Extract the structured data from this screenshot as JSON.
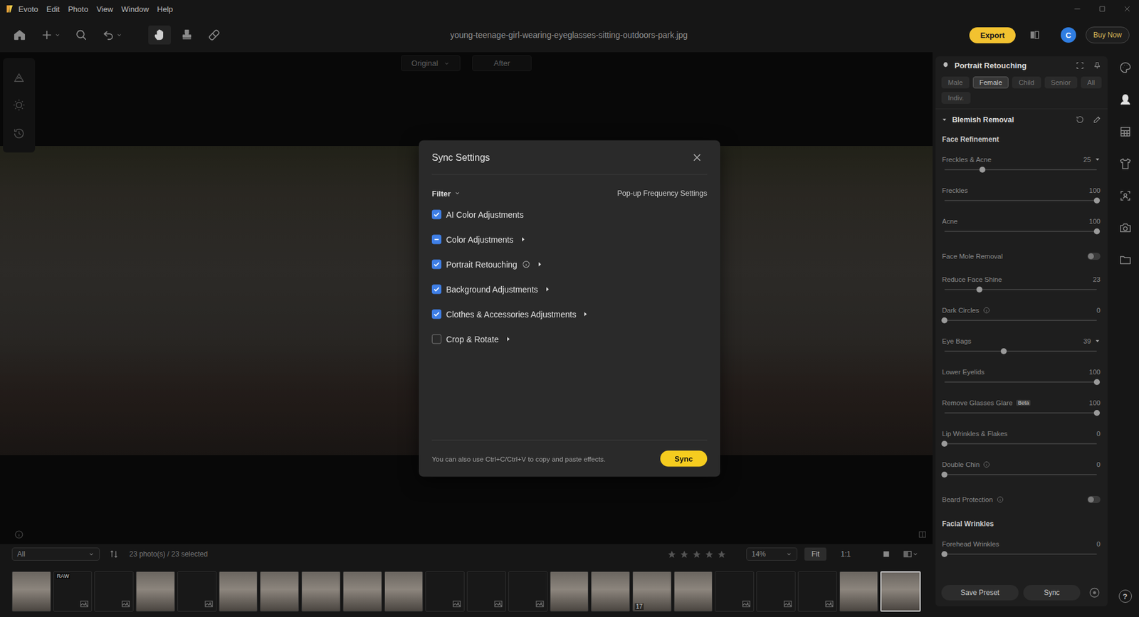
{
  "window": {
    "app": "Evoto",
    "title": "young-teenage-girl-wearing-eyeglasses-sitting-outdoors-park.jpg"
  },
  "menu": [
    "Edit",
    "Photo",
    "View",
    "Window",
    "Help"
  ],
  "toolbar": {
    "tools": [
      {
        "selected": false,
        "dropdown": false
      },
      {
        "selected": false,
        "dropdown": true
      },
      {
        "selected": false,
        "dropdown": false
      },
      {
        "selected": false,
        "dropdown": true
      },
      {
        "selected": true,
        "dropdown": false
      },
      {
        "selected": false,
        "dropdown": false
      },
      {
        "selected": false,
        "dropdown": false
      }
    ],
    "export": "Export",
    "avatar": "C",
    "buy": "Buy Now"
  },
  "left_tools": [
    {
      "selected": false
    },
    {
      "selected": false
    },
    {
      "selected": false
    }
  ],
  "view_toggle": [
    {
      "label": "Original",
      "dropdown": true
    },
    {
      "label": "After",
      "dropdown": false
    }
  ],
  "dialog": {
    "title": "Sync Settings",
    "filter": "Filter",
    "frequency": "Pop-up Frequency Settings",
    "items": [
      {
        "label": "AI Color Adjustments",
        "checked": true,
        "partial": false,
        "info": false,
        "expandable": false
      },
      {
        "label": "Color Adjustments",
        "checked": false,
        "partial": true,
        "info": false,
        "expandable": true
      },
      {
        "label": "Portrait Retouching",
        "checked": true,
        "partial": false,
        "info": true,
        "expandable": true
      },
      {
        "label": "Background Adjustments",
        "checked": true,
        "partial": false,
        "info": false,
        "expandable": true
      },
      {
        "label": "Clothes & Accessories Adjustments",
        "checked": true,
        "partial": false,
        "info": false,
        "expandable": true
      },
      {
        "label": "Crop & Rotate",
        "checked": false,
        "partial": false,
        "info": false,
        "expandable": true
      }
    ],
    "hint": "You can also use Ctrl+C/Ctrl+V to copy and paste effects.",
    "button": "Sync"
  },
  "panel": {
    "title": "Portrait Retouching",
    "profiles": [
      {
        "label": "Male",
        "selected": false
      },
      {
        "label": "Female",
        "selected": true
      },
      {
        "label": "Child",
        "selected": false
      },
      {
        "label": "Senior",
        "selected": false
      },
      {
        "label": "All",
        "selected": false
      },
      {
        "label": "Indiv.",
        "selected": false
      }
    ],
    "section": {
      "title": "Blemish Removal",
      "expanded": true
    },
    "rows": [
      {
        "kind": "heading",
        "label": "Face Refinement"
      },
      {
        "kind": "slider",
        "label": "Freckles & Acne",
        "value": "25",
        "level": 0.25,
        "expanded": true
      },
      {
        "kind": "slider",
        "label": "Freckles",
        "value": "100",
        "level": 1
      },
      {
        "kind": "slider",
        "label": "Acne",
        "value": "100",
        "level": 1
      },
      {
        "kind": "toggle",
        "label": "Face Mole Removal",
        "on": false
      },
      {
        "kind": "slider",
        "label": "Reduce Face Shine",
        "value": "23",
        "level": 0.23
      },
      {
        "kind": "slider",
        "label": "Dark Circles",
        "value": "0",
        "level": 0,
        "info": true
      },
      {
        "kind": "slider",
        "label": "Eye Bags",
        "value": "39",
        "level": 0.39,
        "expanded": true
      },
      {
        "kind": "slider",
        "label": "Lower Eyelids",
        "value": "100",
        "level": 1
      },
      {
        "kind": "slider",
        "label": "Remove Glasses Glare",
        "badge": "Beta",
        "value": "100",
        "level": 1
      },
      {
        "kind": "slider",
        "label": "Lip Wrinkles & Flakes",
        "value": "0",
        "level": 0
      },
      {
        "kind": "slider",
        "label": "Double Chin",
        "value": "0",
        "level": 0,
        "info": true
      },
      {
        "kind": "toggle",
        "label": "Beard Protection",
        "on": false,
        "info": true
      },
      {
        "kind": "heading",
        "label": "Facial Wrinkles"
      },
      {
        "kind": "slider",
        "label": "Forehead Wrinkles",
        "value": "0",
        "level": 0
      }
    ],
    "buttons": [
      "Save Preset",
      "Sync"
    ]
  },
  "side_tools": [
    {
      "selected": false
    },
    {
      "selected": true
    },
    {
      "selected": false
    },
    {
      "selected": false
    },
    {
      "selected": false
    },
    {
      "selected": false
    },
    {
      "selected": false
    }
  ],
  "help": "?",
  "filmstrip": {
    "filter": "All",
    "count": "23 photo(s) / 23 selected",
    "stars": 0,
    "zoom": "14%",
    "fit": {
      "label": "Fit",
      "selected": true
    },
    "actual": {
      "label": "1:1",
      "selected": false
    },
    "photos": [
      {
        "kind": "photo",
        "selected": false
      },
      {
        "kind": "empty",
        "selected": false,
        "badge": "RAW"
      },
      {
        "kind": "empty",
        "selected": false
      },
      {
        "kind": "photo",
        "selected": false
      },
      {
        "kind": "empty",
        "selected": false
      },
      {
        "kind": "photo",
        "selected": false
      },
      {
        "kind": "photo",
        "selected": false
      },
      {
        "kind": "photo",
        "selected": false
      },
      {
        "kind": "photo",
        "selected": false
      },
      {
        "kind": "photo",
        "selected": false
      },
      {
        "kind": "empty",
        "selected": false
      },
      {
        "kind": "empty",
        "selected": false
      },
      {
        "kind": "empty",
        "selected": false
      },
      {
        "kind": "photo",
        "selected": false
      },
      {
        "kind": "photo",
        "selected": false
      },
      {
        "kind": "photo",
        "selected": false,
        "badge": "17"
      },
      {
        "kind": "photo",
        "selected": false
      },
      {
        "kind": "empty",
        "selected": false
      },
      {
        "kind": "empty",
        "selected": false
      },
      {
        "kind": "empty",
        "selected": false
      },
      {
        "kind": "photo",
        "selected": false
      },
      {
        "kind": "photo",
        "selected": true
      }
    ]
  }
}
